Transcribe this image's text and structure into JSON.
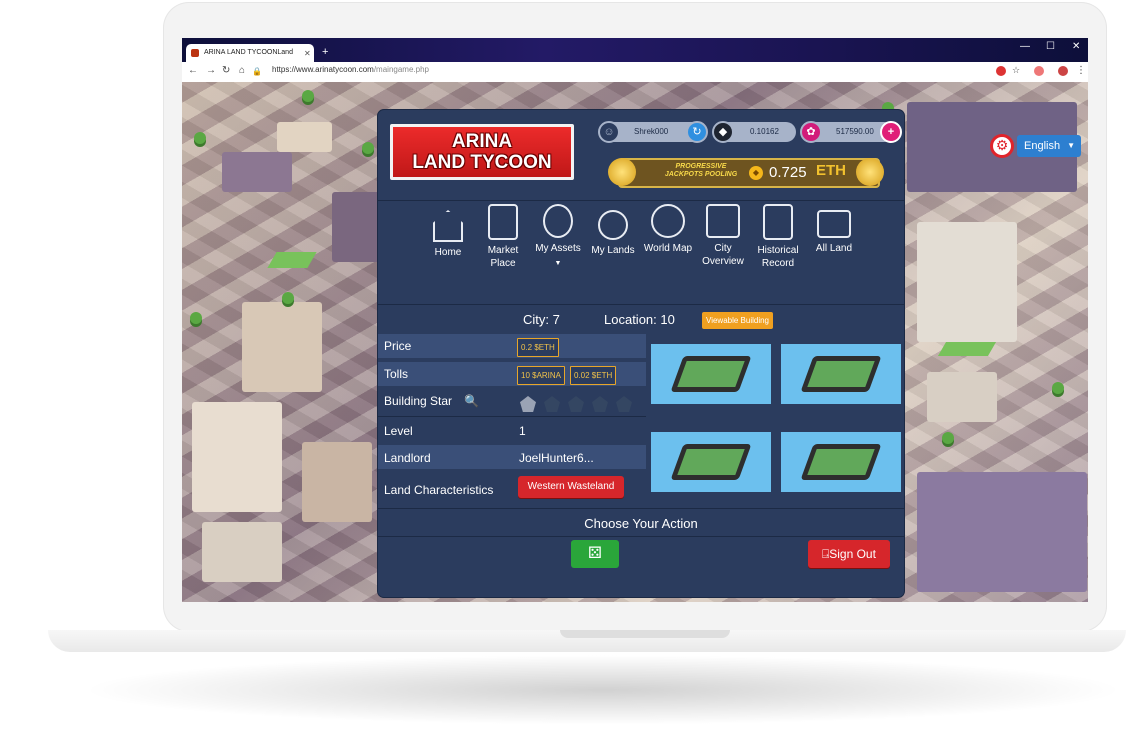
{
  "browser": {
    "tab_title": "ARINA LAND TYCOONLand",
    "tab_close": "✕",
    "new_tab": "+",
    "url_host": "https://www.arinatycoon.com",
    "url_path": "/maingame.php",
    "window_controls": [
      "—",
      "☐",
      "✕"
    ]
  },
  "settings": {
    "language": "English"
  },
  "header": {
    "logo_line1": "ARINA",
    "logo_line2": "LAND TYCOON",
    "username": "Shrek000",
    "eth_balance": "0.10162",
    "arina_balance": "517590.00",
    "jackpot_label": "PROGRESSIVE JACKPOTS POOLING",
    "jackpot_value": "0.725",
    "jackpot_unit": "ETH"
  },
  "nav": [
    {
      "label": "Home",
      "icon": "house-icon"
    },
    {
      "label": "Market Place",
      "icon": "market-stall-icon"
    },
    {
      "label": "My Assets",
      "icon": "money-bag-icon"
    },
    {
      "label": "My Lands",
      "icon": "map-pin-icon"
    },
    {
      "label": "World Map",
      "icon": "globe-icon"
    },
    {
      "label": "City Overview",
      "icon": "folded-map-icon"
    },
    {
      "label": "Historical Record",
      "icon": "document-icon"
    },
    {
      "label": "All Land",
      "icon": "map-search-icon"
    }
  ],
  "location": {
    "city": "City: 7",
    "location": "Location: 10",
    "viewable_button": "Viewable Building"
  },
  "details": {
    "price_label": "Price",
    "price_value": "0.2 $ETH",
    "tolls_label": "Tolls",
    "tolls_arina": "10 $ARINA",
    "tolls_eth": "0.02 $ETH",
    "building_star_label": "Building Star",
    "building_star_count": 1,
    "building_star_max": 5,
    "level_label": "Level",
    "level_value": "1",
    "landlord_label": "Landlord",
    "landlord_value": "JoelHunter6...",
    "characteristics_label": "Land Characteristics",
    "characteristics_value": "Western Wasteland"
  },
  "actions": {
    "title": "Choose Your Action",
    "dice_icon": "dice-icon",
    "sign_out": "Sign Out"
  },
  "colors": {
    "panel_bg": "#2b3c5e",
    "accent_red": "#d6262b",
    "accent_green": "#2aa63a",
    "accent_orange": "#f0a020",
    "language_blue": "#2d7fd0"
  }
}
